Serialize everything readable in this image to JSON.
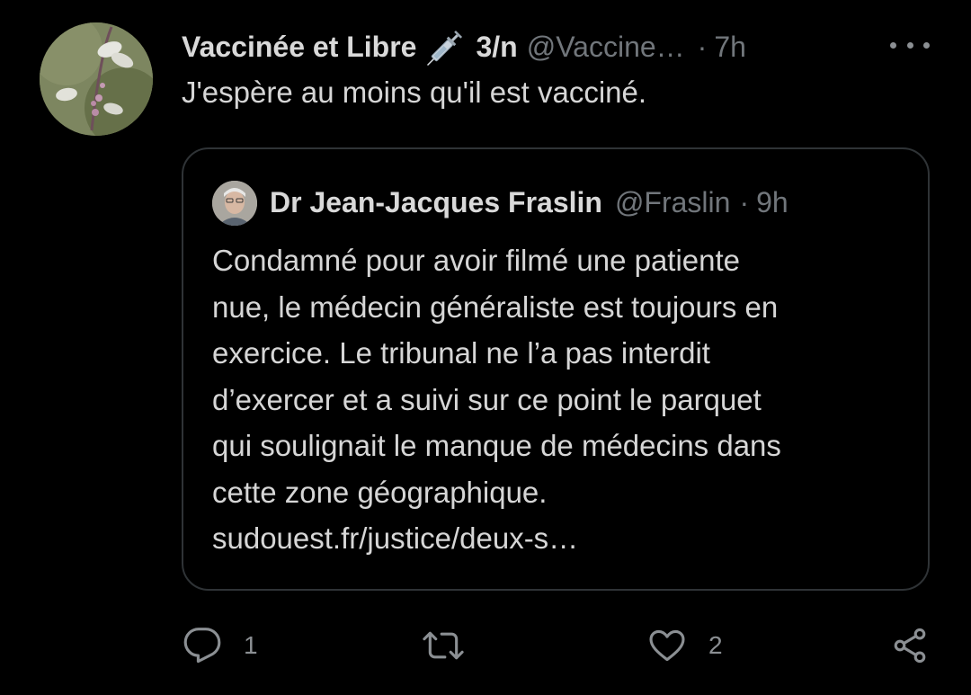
{
  "tweet": {
    "display_name": "Vaccinée et Libre",
    "emoji_icon": "syringe-icon",
    "thread_count": "3/n",
    "handle": "@Vaccine…",
    "separator": "·",
    "time": "7h",
    "text": "J'espère au moins qu'il est vacciné."
  },
  "quote": {
    "display_name": "Dr Jean-Jacques Fraslin",
    "handle": "@Fraslin",
    "separator": "·",
    "time": "9h",
    "lines": [
      "Condamné pour avoir filmé une patiente",
      "nue, le médecin généraliste est toujours en",
      "exercice. Le tribunal ne l’a pas interdit",
      "d’exercer et a suivi sur ce point le parquet",
      "qui soulignait le manque de médecins dans",
      "cette zone géographique.",
      "sudouest.fr/justice/deux-s…"
    ]
  },
  "actions": {
    "reply_count": "1",
    "retweet_count": "",
    "like_count": "2"
  },
  "colors": {
    "background": "#000000",
    "text": "#d6d6d6",
    "muted": "#71767b",
    "border": "#2f3336"
  }
}
